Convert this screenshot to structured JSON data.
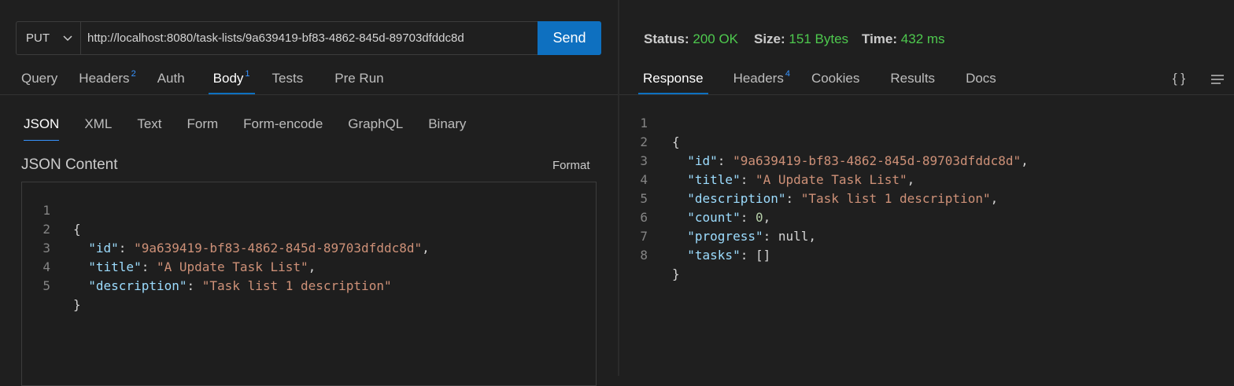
{
  "request": {
    "method": "PUT",
    "url": "http://localhost:8080/task-lists/9a639419-bf83-4862-845d-89703dfddc8d",
    "send_label": "Send",
    "tabs": [
      {
        "label": "Query",
        "badge": ""
      },
      {
        "label": "Headers",
        "badge": "2"
      },
      {
        "label": "Auth",
        "badge": ""
      },
      {
        "label": "Body",
        "badge": "1"
      },
      {
        "label": "Tests",
        "badge": ""
      },
      {
        "label": "Pre Run",
        "badge": ""
      }
    ],
    "active_tab": "Body",
    "body_types": [
      "JSON",
      "XML",
      "Text",
      "Form",
      "Form-encode",
      "GraphQL",
      "Binary"
    ],
    "active_body_type": "JSON",
    "section_title": "JSON Content",
    "format_label": "Format",
    "editor_lines": [
      {
        "num": "1",
        "text": "{"
      },
      {
        "num": "2",
        "text": "  \"id\": \"9a639419-bf83-4862-845d-89703dfddc8d\","
      },
      {
        "num": "3",
        "text": "  \"title\": \"A Update Task List\","
      },
      {
        "num": "4",
        "text": "  \"description\": \"Task list 1 description\""
      },
      {
        "num": "5",
        "text": "}"
      }
    ]
  },
  "response": {
    "status_label": "Status:",
    "status_value": "200 OK",
    "size_label": "Size:",
    "size_value": "151 Bytes",
    "time_label": "Time:",
    "time_value": "432 ms",
    "status_color": "#4ec94e",
    "tabs": [
      {
        "label": "Response",
        "badge": ""
      },
      {
        "label": "Headers",
        "badge": "4"
      },
      {
        "label": "Cookies",
        "badge": ""
      },
      {
        "label": "Results",
        "badge": ""
      },
      {
        "label": "Docs",
        "badge": ""
      }
    ],
    "active_tab": "Response",
    "icon_braces": "{ }",
    "icon_menu": "menu-icon",
    "lines": [
      {
        "num": "1",
        "text": "{"
      },
      {
        "num": "2",
        "text": "  \"id\": \"9a639419-bf83-4862-845d-89703dfddc8d\","
      },
      {
        "num": "3",
        "text": "  \"title\": \"A Update Task List\","
      },
      {
        "num": "4",
        "text": "  \"description\": \"Task list 1 description\","
      },
      {
        "num": "5",
        "text": "  \"count\": 0,"
      },
      {
        "num": "6",
        "text": "  \"progress\": null,"
      },
      {
        "num": "7",
        "text": "  \"tasks\": []"
      },
      {
        "num": "8",
        "text": "}"
      }
    ]
  },
  "colors": {
    "accent": "#0e70c0",
    "badge": "#3794ff",
    "json_key": "#9cdcfe",
    "json_string": "#ce9178",
    "json_number": "#b5cea8",
    "background": "#1f1f1f"
  }
}
